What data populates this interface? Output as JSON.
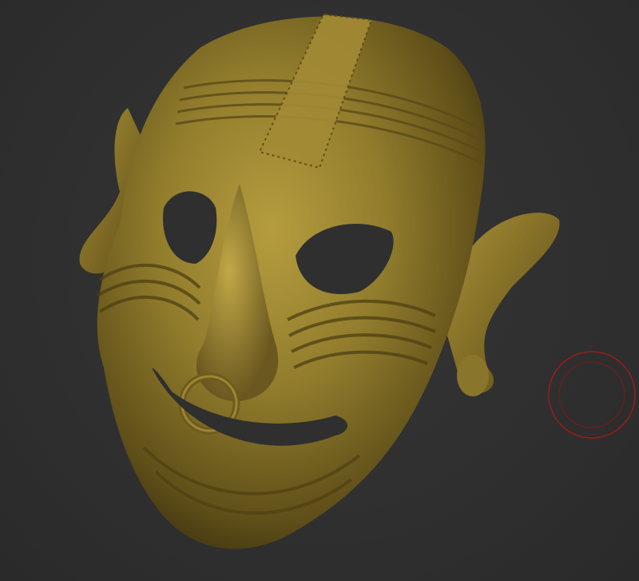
{
  "viewport": {
    "background_color": "#2f2f2f",
    "model": {
      "name": "",
      "material_color": "#8c7a2c",
      "highlight_color": "#c9b14e",
      "shadow_color": "#3f3410"
    },
    "brush_cursor": {
      "icon": "brush-circle-icon",
      "color": "#9a1c1c"
    }
  }
}
